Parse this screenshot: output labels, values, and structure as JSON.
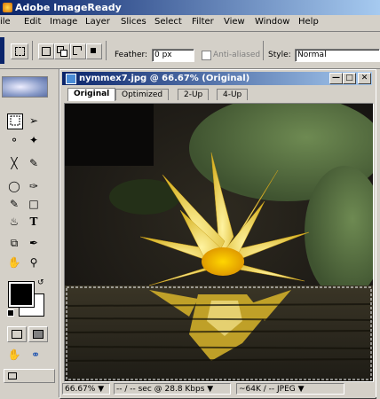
{
  "app": {
    "title": "Adobe ImageReady"
  },
  "menu": [
    "ile",
    "Edit",
    "Image",
    "Layer",
    "Slices",
    "Select",
    "Filter",
    "View",
    "Window",
    "Help"
  ],
  "options": {
    "feather_label": "Feather:",
    "feather_value": "0 px",
    "antialiased_label": "Anti-aliased",
    "style_label": "Style:",
    "style_value": "Normal"
  },
  "toolbox": {
    "icons": [
      "marquee-icon",
      "move-icon",
      "lasso-icon",
      "magic-wand-icon",
      "crop-icon",
      "slice-icon",
      "eraser-icon",
      "brush-icon",
      "pencil-icon",
      "rectangle-icon",
      "paint-bucket-icon",
      "type-icon",
      "eyedropper-icon",
      "hand-icon",
      "zoom-icon"
    ]
  },
  "colors": {
    "foreground": "#000000",
    "background": "#ffffff",
    "accent": "#0a246a"
  },
  "document": {
    "title": "nymmex7.jpg @ 66.67% (Original)",
    "tabs": [
      {
        "label": "Original",
        "active": true
      },
      {
        "label": "Optimized",
        "active": false
      },
      {
        "label": "2-Up",
        "active": false
      },
      {
        "label": "4-Up",
        "active": false
      }
    ]
  },
  "status": {
    "zoom": "66.67%",
    "timing": "-- / -- sec @ 28.8 Kbps",
    "size": "~64K / -- JPEG"
  }
}
